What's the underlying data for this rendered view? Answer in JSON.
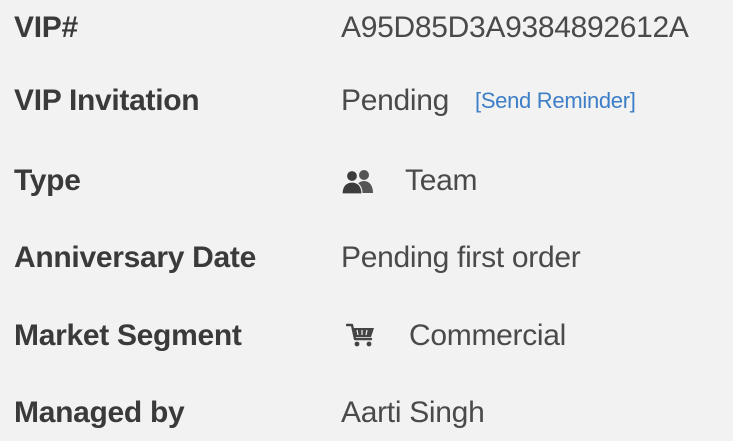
{
  "fields": {
    "vip": {
      "label": "VIP#",
      "value": "A95D85D3A9384892612A"
    },
    "invitation": {
      "label": "VIP Invitation",
      "value": "Pending",
      "link_open": "[",
      "link": "Send Reminder",
      "link_close": "]"
    },
    "type": {
      "label": "Type",
      "value": "Team",
      "icon": "team-icon"
    },
    "anniversary": {
      "label": "Anniversary Date",
      "value": "Pending first order"
    },
    "segment": {
      "label": "Market Segment",
      "value": "Commercial",
      "icon": "shopping-cart-icon"
    },
    "managed": {
      "label": "Managed by",
      "value": "Aarti Singh"
    }
  },
  "colors": {
    "background": "#f2f2f2",
    "label_text": "#3a3a3a",
    "value_text": "#4a4a4a",
    "link": "#3d7ec7"
  }
}
